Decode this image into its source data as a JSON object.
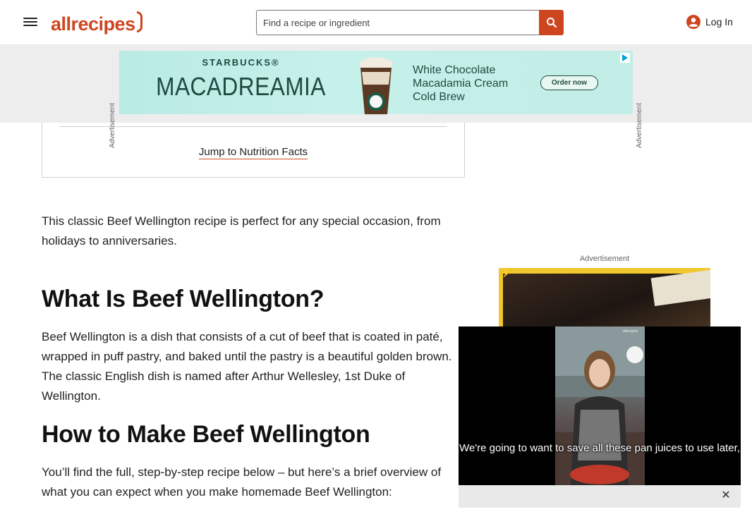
{
  "header": {
    "logo_text": "allrecipes",
    "search_placeholder": "Find a recipe or ingredient",
    "login_label": "Log In"
  },
  "top_ad": {
    "side_label": "Advertisement",
    "brand": "STARBUCKS®",
    "product": "MACADREAMIA",
    "headline": "White Chocolate Macadamia Cream Cold Brew",
    "cta": "Order now"
  },
  "recipe_card": {
    "jump_link": "Jump to Nutrition Facts"
  },
  "article": {
    "intro": "This classic Beef Wellington recipe is perfect for any special occasion, from holidays to anniversaries.",
    "heading_1": "What Is Beef Wellington?",
    "para_1": "Beef Wellington is a dish that consists of a cut of beef that is coated in paté, wrapped in puff pastry, and baked until the pastry is a beautiful golden brown. The classic English dish is named after Arthur Wellesley, 1st Duke of Wellington.",
    "heading_2": "How to Make Beef Wellington",
    "para_2": "You’ll find the full, step-by-step recipe below – but here’s a brief overview of what you can expect when you make homemade Beef Wellington:"
  },
  "right_ad": {
    "label": "Advertisement"
  },
  "video": {
    "caption": "We're going to want to save all these pan juices to use later,",
    "watermark": "allrecipes",
    "close_symbol": "✕"
  },
  "colors": {
    "brand": "#ce4620",
    "ad_bg": "#c2eee7",
    "ad_text": "#1f4a40"
  }
}
